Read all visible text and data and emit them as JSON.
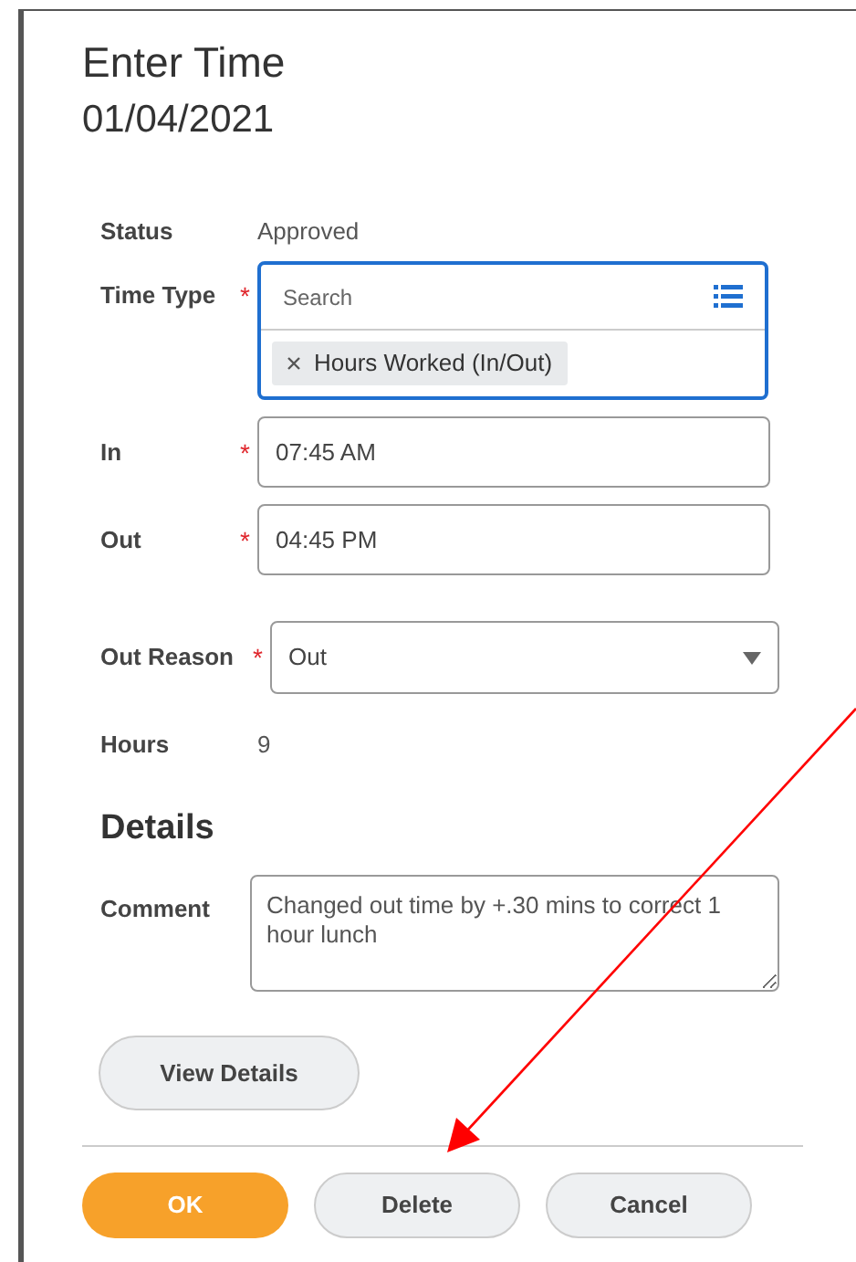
{
  "title": "Enter Time",
  "date": "01/04/2021",
  "fields": [
    {
      "kind": "text",
      "label": "Status",
      "value": "Approved"
    },
    {
      "kind": "multiselect",
      "label": "Time Type",
      "required_mark": "*",
      "placeholder": "Search",
      "chips": [
        "Hours Worked (In/Out)"
      ],
      "focused": true
    },
    {
      "kind": "input",
      "label": "In",
      "required_mark": "*",
      "value": "07:45 AM"
    },
    {
      "kind": "input",
      "label": "Out",
      "required_mark": "*",
      "value": "04:45 PM"
    },
    {
      "kind": "select",
      "label": "Out Reason",
      "required_mark": "*",
      "value": "Out"
    },
    {
      "kind": "text",
      "label": "Hours",
      "value": "9"
    }
  ],
  "details": {
    "heading": "Details",
    "comment_label": "Comment",
    "comment": "Changed out time by +.30 mins to correct 1 hour lunch",
    "view_button": "View Details"
  },
  "actions": [
    {
      "label": "OK",
      "primary": true
    },
    {
      "label": "Delete",
      "primary": false
    },
    {
      "label": "Cancel",
      "primary": false
    }
  ],
  "annotation_arrow": true
}
